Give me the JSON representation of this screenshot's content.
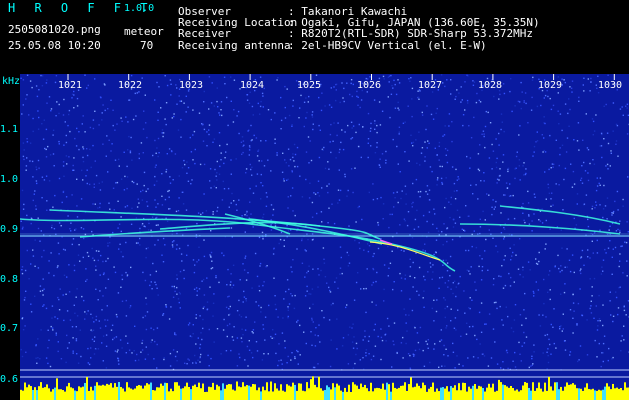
{
  "app": {
    "logo": "H R O F F T",
    "version": "1.0.0"
  },
  "file": {
    "name": "2505081020.png",
    "datetime": "25.05.08 10:20"
  },
  "counter": {
    "label": "meteor",
    "value": "70"
  },
  "info": [
    {
      "label": "Observer",
      "value": ": Takanori Kawachi"
    },
    {
      "label": "Receiving Location",
      "value": ": Ogaki, Gifu, JAPAN (136.60E, 35.35N)"
    },
    {
      "label": "Receiver",
      "value": ": R820T2(RTL-SDR) SDR-Sharp 53.372MHz"
    },
    {
      "label": "Receiving antenna",
      "value": ": 2el-HB9CV Vertical (el. E-W)"
    }
  ],
  "axis": {
    "y_unit": "kHz",
    "y_ticks": [
      "1.1",
      "1.0",
      "0.9",
      "0.8",
      "0.7",
      "0.6"
    ],
    "x_ticks": [
      "1021",
      "1022",
      "1023",
      "1024",
      "1025",
      "1026",
      "1027",
      "1028",
      "1029",
      "1030"
    ]
  },
  "colors": {
    "background": "#0a1aa0",
    "text_cyan": "#00ffff",
    "signal": "#ffff00"
  }
}
